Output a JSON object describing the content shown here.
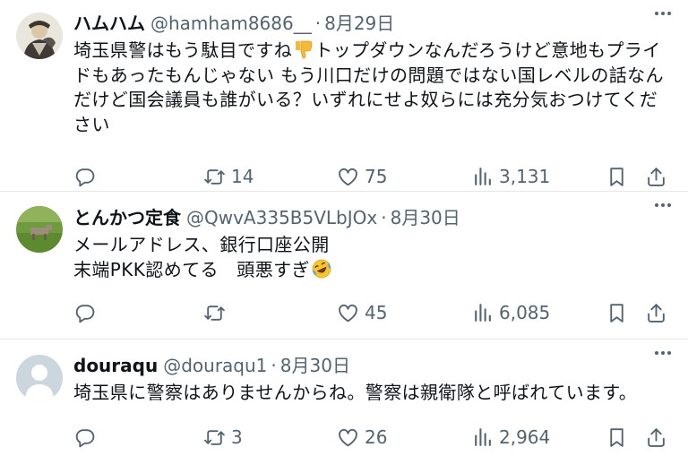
{
  "tweets": [
    {
      "display_name": "ハムハム",
      "handle": "@hamham8686__",
      "date": "8月29日",
      "text": "埼玉県警はもう駄目ですね👎トップダウンなんだろうけど意地もプライドもあったもんじゃない もう川口だけの問題ではない国レベルの話なんだけど国会議員も誰がいる？いずれにせよ奴らには充分気おつけてください",
      "text_before_emoji": "埼玉県警はもう駄目ですね",
      "emoji": "thumbs-down",
      "text_after_emoji": "トップダウンなんだろうけど意地もプライドもあったもんじゃない もう川口だけの問題ではない国レベルの話なんだけど国会議員も誰がいる？いずれにせよ奴らには充分気おつけてください",
      "replies": "",
      "retweets": "14",
      "likes": "75",
      "views": "3,131"
    },
    {
      "display_name": "とんかつ定食",
      "handle": "@QwvA335B5VLbJOx",
      "date": "8月30日",
      "text": "メールアドレス、銀行口座公開\n末端PKK認めてる　頭悪すぎ🤣",
      "text_before_emoji": "メールアドレス、銀行口座公開\n末端PKK認めてる　頭悪すぎ",
      "emoji": "rolling-on-floor-laughing",
      "replies": "",
      "retweets": "",
      "likes": "45",
      "views": "6,085"
    },
    {
      "display_name": "douraqu",
      "handle": "@douraqu1",
      "date": "8月30日",
      "text": "埼玉県に警察はありませんからね。警察は親衛隊と呼ばれています。",
      "replies": "",
      "retweets": "3",
      "likes": "26",
      "views": "2,964"
    }
  ],
  "separator": "·",
  "colors": {
    "text_primary": "#0f1419",
    "text_secondary": "#536471",
    "divider": "#e6e9eb",
    "thumbs_emoji": "#f5b93a"
  },
  "icons": [
    "reply-icon",
    "retweet-icon",
    "like-icon",
    "views-icon",
    "bookmark-icon",
    "share-icon",
    "more-icon"
  ]
}
